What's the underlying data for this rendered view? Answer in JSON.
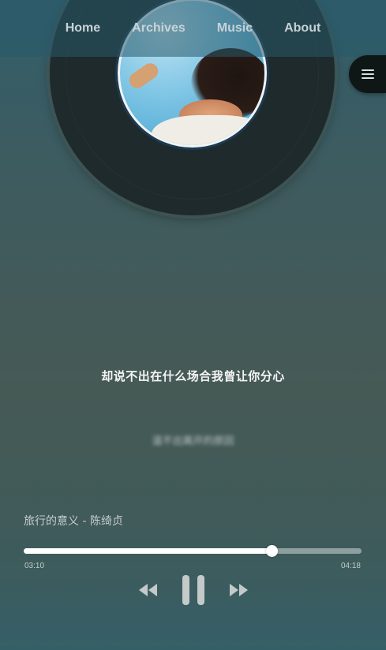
{
  "nav": {
    "items": [
      {
        "label": "Home"
      },
      {
        "label": "Archives"
      },
      {
        "label": "Music"
      },
      {
        "label": "About"
      }
    ],
    "menu_icon": "hamburger-menu-icon"
  },
  "player": {
    "lyrics": {
      "current": "却说不出在什么场合我曾让你分心",
      "next": "温不出离开的原因"
    },
    "song_title": "旅行的意义 - 陈绮贞",
    "progress": {
      "current_time": "03:10",
      "total_time": "04:18",
      "fraction": 0.734
    },
    "controls": {
      "prev_icon": "rewind-icon",
      "play_pause_icon": "pause-icon",
      "next_icon": "fast-forward-icon"
    }
  },
  "colors": {
    "accent": "#ffffff",
    "nav_text": "#c7d2d6",
    "disc": "#1e2a2c"
  }
}
